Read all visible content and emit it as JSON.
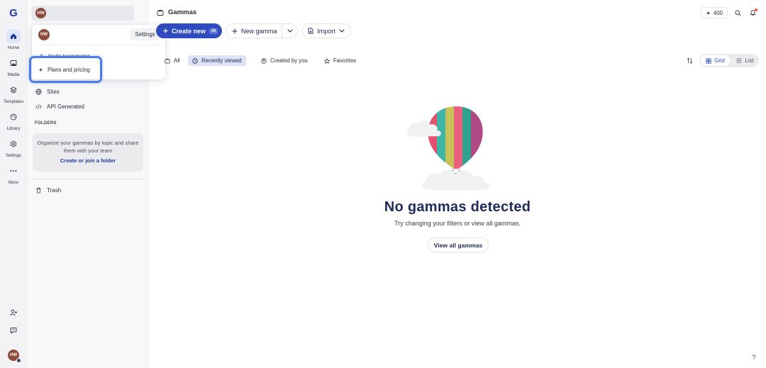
{
  "colors": {
    "accent": "#2f4bbf",
    "rail_active": "#e0e6f7",
    "focus_ring": "#4b7bea",
    "avatar": "#8b4a3a"
  },
  "rail": {
    "logo": "G",
    "items": [
      {
        "label": "Home",
        "icon": "home-icon"
      },
      {
        "label": "Media",
        "icon": "image-icon"
      },
      {
        "label": "Templates",
        "icon": "layers-icon"
      },
      {
        "label": "Library",
        "icon": "palette-icon"
      },
      {
        "label": "Settings",
        "icon": "gear-icon"
      },
      {
        "label": "More",
        "icon": "more-icon"
      }
    ],
    "avatar_initials": "HW"
  },
  "sidebar": {
    "workspace_initials": "HW",
    "links": [
      {
        "label": "Sites",
        "icon": "globe-icon"
      },
      {
        "label": "API Generated",
        "icon": "code-icon"
      }
    ],
    "folders_header": "FOLDERS",
    "folders_text": "Organize your gammas by topic and share them with your team",
    "folders_link": "Create or join a folder",
    "trash": "Trash"
  },
  "popup": {
    "avatar_initials": "HW",
    "settings": "Settings",
    "invite": "Invite teammates",
    "plans": "Plans and pricing"
  },
  "header": {
    "title": "Gammas",
    "credits": "400"
  },
  "toolbar": {
    "create_new": "Create new",
    "ai_badge": "AI",
    "new_gamma": "New gamma",
    "import": "Import"
  },
  "filters": [
    {
      "label": "All"
    },
    {
      "label": "Recently viewed",
      "active": true
    },
    {
      "label": "Created by you"
    },
    {
      "label": "Favorites"
    }
  ],
  "view": {
    "grid": "Grid",
    "list": "List",
    "selected": "Grid"
  },
  "empty_state": {
    "title": "No gammas detected",
    "subtitle": "Try changing your filters or view all gammas.",
    "button": "View all gammas"
  },
  "help": "?"
}
